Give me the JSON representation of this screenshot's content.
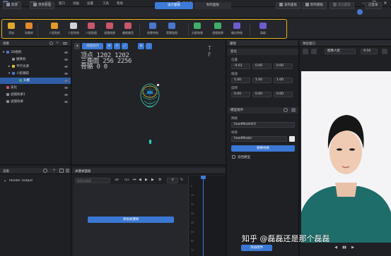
{
  "titlebar": {
    "menus": [
      "文件",
      "编辑",
      "视图",
      "窗口",
      "动画",
      "设置",
      "工具",
      "帮助"
    ],
    "doc_title": "未命名",
    "win_controls": [
      "–",
      "❐",
      "✕"
    ]
  },
  "row2": {
    "left_buttons": [
      "新建",
      "项目管理"
    ],
    "segments": [
      "设计面板",
      "制作面板"
    ],
    "right_buttons": [
      "发布面板",
      "制作模板",
      "退出面板"
    ],
    "user": "已登录"
  },
  "toolbar": {
    "tools": [
      {
        "label": "添加",
        "color": "#e0a72a"
      },
      {
        "label": "场景库",
        "color": "#e08a2a"
      },
      {
        "label": "人脸贴纸",
        "color": "#e09a2a"
      },
      {
        "label": "人脸特效",
        "color": "#d1d3d8"
      },
      {
        "label": "人脸贴图",
        "color": "#c9566b"
      },
      {
        "label": "滤镜效果",
        "color": "#c9566b"
      },
      {
        "label": "美颜美型",
        "color": "#c9566b"
      },
      {
        "label": "前景特效",
        "color": "#4a76d0"
      },
      {
        "label": "背景贴图",
        "color": "#4a76d0"
      },
      {
        "label": "分屏效果",
        "color": "#3fae6a"
      },
      {
        "label": "滤镜效果",
        "color": "#3fae6a"
      },
      {
        "label": "输出特效",
        "color": "#6d5bd0"
      },
      {
        "label": "高级",
        "color": "#6d5bd0"
      }
    ]
  },
  "scene": {
    "title": "场景",
    "tree": [
      {
        "label": "3D相机",
        "indent": 4,
        "arrow": "▾",
        "color": "#4a76d0",
        "selected": false
      },
      {
        "label": "摄像机",
        "indent": 12,
        "arrow": "",
        "color": "#8a8f9c",
        "selected": false
      },
      {
        "label": "平行光源",
        "indent": 12,
        "arrow": "▸",
        "color": "#e0c02a",
        "selected": false
      },
      {
        "label": "人脸跟踪",
        "indent": 12,
        "arrow": "▾",
        "color": "#4a76d0",
        "selected": false
      },
      {
        "label": "头模",
        "indent": 22,
        "arrow": "",
        "color": "#3fae6a",
        "selected": true
      },
      {
        "label": "美化",
        "indent": 4,
        "arrow": "",
        "color": "#c9566b",
        "selected": false
      },
      {
        "label": "滤镜效果1",
        "indent": 4,
        "arrow": "",
        "color": "#8a8f9c",
        "selected": false
      },
      {
        "label": "滤镜效果",
        "indent": 4,
        "arrow": "",
        "color": "#8a8f9c",
        "selected": false
      }
    ]
  },
  "render": {
    "title": "渲染",
    "item": "Render Output"
  },
  "viewport": {
    "tab_label": "视图操作",
    "stats": [
      "顶点  1202  1202",
      "三角面 256  2256",
      "骨骼    0     0"
    ],
    "axis_labels": [
      "T",
      "F"
    ]
  },
  "timeline": {
    "title": "关键帧面板",
    "search_placeholder": "搜索关键帧",
    "fps_value": "30",
    "fps_label": "fps",
    "frame_value": "0",
    "ruler": [
      "0",
      "10",
      "20",
      "30",
      "40",
      "50",
      "60",
      "70"
    ],
    "add_button": "添加关键帧"
  },
  "props": {
    "title": "属性",
    "component": "变化",
    "rows": [
      {
        "label": "位置",
        "values": [
          "-0.01",
          "0.00",
          "0.00"
        ]
      },
      {
        "label": "缩放",
        "values": [
          "1.00",
          "1.00",
          "1.00"
        ]
      },
      {
        "label": "旋转",
        "values": [
          "0.00",
          "0.00",
          "0.00"
        ]
      }
    ],
    "section2": "模型组件",
    "model_label": "网格",
    "model_value": "headModelV3",
    "material_label": "材质",
    "material_value": "headModel",
    "replace_button": "替换材质",
    "checkbox_label": "遮挡模型",
    "bottom_button": "添加组件"
  },
  "preview": {
    "title": "预览窗口",
    "select_value": "图像人脸",
    "zoom_value": "9:16",
    "bottom_controls": [
      "◀",
      "▮▮",
      "▶"
    ]
  },
  "watermark": "知乎 @磊磊还是那个磊磊"
}
